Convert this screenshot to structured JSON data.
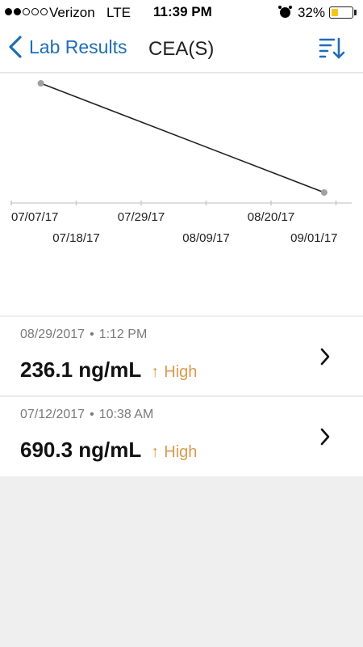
{
  "status_bar": {
    "signal_bars_filled": 2,
    "signal_bars_total": 5,
    "carrier": "Verizon",
    "network": "LTE",
    "time": "11:39 PM",
    "alarm_icon": "alarm-clock-icon",
    "battery_percent": "32%",
    "battery_level": 0.32,
    "battery_color": "#f5c518"
  },
  "nav": {
    "back_label": "Lab Results",
    "title": "CEA(S)",
    "back_icon": "chevron-left-icon",
    "sort_icon": "sort-icon",
    "accent_color": "#1f6db5"
  },
  "chart_data": {
    "type": "line",
    "title": "",
    "xlabel": "",
    "ylabel": "",
    "x_ticks": [
      "07/07/17",
      "07/18/17",
      "07/29/17",
      "08/09/17",
      "08/20/17",
      "09/01/17"
    ],
    "points": [
      {
        "x": "07/12/17",
        "y": 690.3
      },
      {
        "x": "08/29/17",
        "y": 236.1
      }
    ],
    "grid": false,
    "y_axis_shown": false
  },
  "results": [
    {
      "date": "08/29/2017",
      "time": "1:12 PM",
      "value": "236.1 ng/mL",
      "flag": "High",
      "flag_arrow": "↑"
    },
    {
      "date": "07/12/2017",
      "time": "10:38 AM",
      "value": "690.3 ng/mL",
      "flag": "High",
      "flag_arrow": "↑"
    }
  ],
  "colors": {
    "flag_high": "#d99a50",
    "line": "#222222",
    "point": "#a0a0a0"
  }
}
